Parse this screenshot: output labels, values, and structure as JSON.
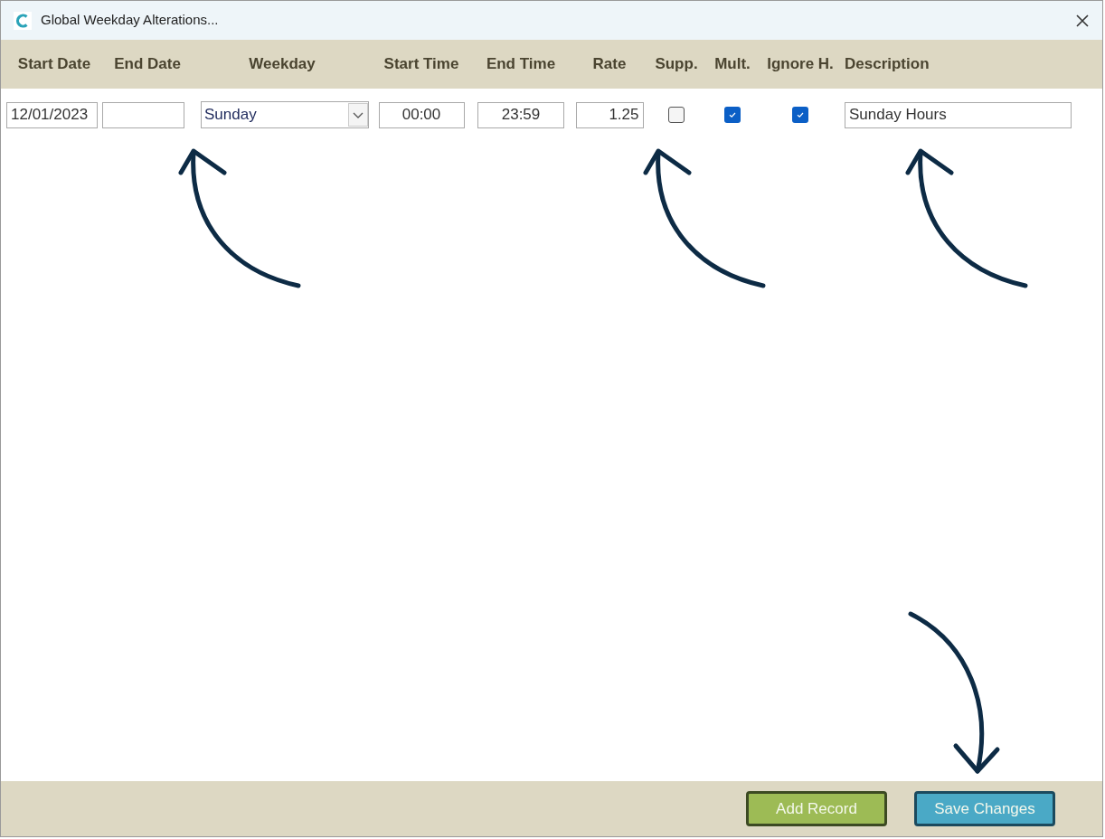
{
  "window": {
    "title": "Global Weekday Alterations..."
  },
  "columns": [
    "Start Date",
    "End Date",
    "Weekday",
    "Start Time",
    "End Time",
    "Rate",
    "Supp.",
    "Mult.",
    "Ignore H.",
    "Description"
  ],
  "rows": [
    {
      "cells": [
        {
          "kind": "text",
          "value": "12/01/2023"
        },
        {
          "kind": "text"
        },
        {
          "kind": "dropdown",
          "value": "Sunday"
        },
        {
          "kind": "text",
          "value": "00:00"
        },
        {
          "kind": "text",
          "value": "23:59"
        },
        {
          "kind": "text",
          "value": "1.25"
        },
        {
          "kind": "checkbox",
          "checked": false
        },
        {
          "kind": "checkbox",
          "checked": true
        },
        {
          "kind": "checkbox",
          "checked": true
        },
        {
          "kind": "text",
          "value": "Sunday Hours"
        }
      ]
    }
  ],
  "buttons": [
    {
      "kind": "add",
      "label": "Add Record"
    },
    {
      "kind": "save",
      "label": "Save Changes"
    }
  ]
}
